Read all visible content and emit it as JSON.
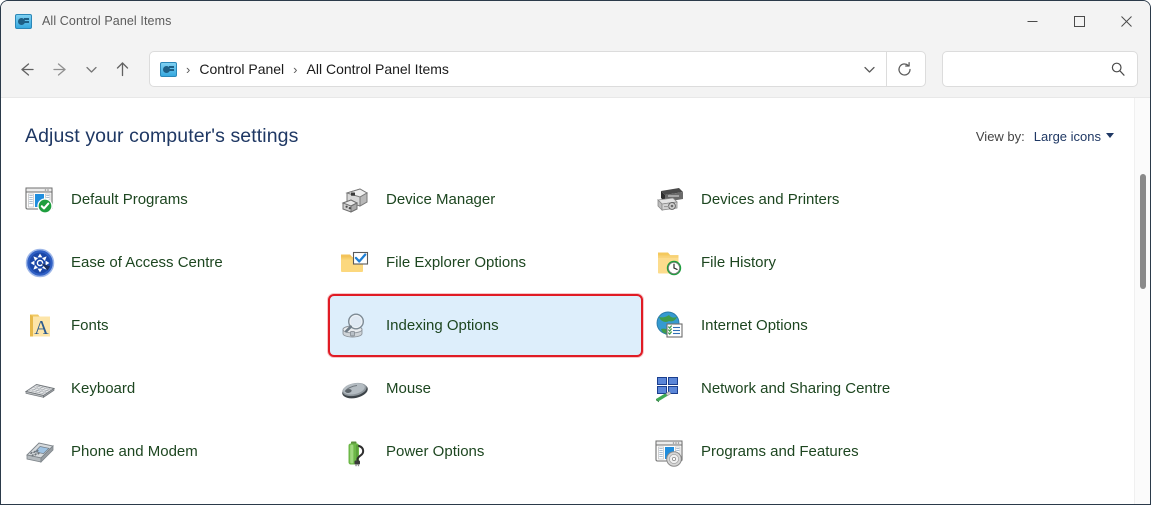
{
  "window": {
    "title": "All Control Panel Items",
    "title_icon": "control-panel-icon",
    "minimize_label": "Minimise",
    "maximize_label": "Maximise",
    "close_label": "Close"
  },
  "nav": {
    "back_label": "Back",
    "forward_label": "Forward",
    "recent_label": "Recent locations",
    "up_label": "Up",
    "dropdown_label": "Previous locations",
    "refresh_label": "Refresh",
    "breadcrumbs": [
      {
        "label": "Control Panel"
      },
      {
        "label": "All Control Panel Items"
      }
    ],
    "separator": "›"
  },
  "search": {
    "value": "",
    "placeholder": "",
    "icon": "search-icon"
  },
  "header": {
    "title": "Adjust your computer's settings",
    "view_by_label": "View by:",
    "view_by_value": "Large icons"
  },
  "colors": {
    "link_text": "#1d4620",
    "page_title": "#1f3864",
    "highlight_border": "#e01b24",
    "highlight_fill": "#ddeefb",
    "window_chrome": "#f3f3f3"
  },
  "items": [
    {
      "label": "Default Programs",
      "icon": "default-programs-icon",
      "highlighted": false
    },
    {
      "label": "Device Manager",
      "icon": "device-manager-icon",
      "highlighted": false
    },
    {
      "label": "Devices and Printers",
      "icon": "devices-and-printers-icon",
      "highlighted": false
    },
    {
      "label": "Ease of Access Centre",
      "icon": "ease-of-access-icon",
      "highlighted": false
    },
    {
      "label": "File Explorer Options",
      "icon": "file-explorer-options-icon",
      "highlighted": false
    },
    {
      "label": "File History",
      "icon": "file-history-icon",
      "highlighted": false
    },
    {
      "label": "Fonts",
      "icon": "fonts-icon",
      "highlighted": false
    },
    {
      "label": "Indexing Options",
      "icon": "indexing-options-icon",
      "highlighted": true
    },
    {
      "label": "Internet Options",
      "icon": "internet-options-icon",
      "highlighted": false
    },
    {
      "label": "Keyboard",
      "icon": "keyboard-icon",
      "highlighted": false
    },
    {
      "label": "Mouse",
      "icon": "mouse-icon",
      "highlighted": false
    },
    {
      "label": "Network and Sharing Centre",
      "icon": "network-sharing-icon",
      "highlighted": false
    },
    {
      "label": "Phone and Modem",
      "icon": "phone-and-modem-icon",
      "highlighted": false
    },
    {
      "label": "Power Options",
      "icon": "power-options-icon",
      "highlighted": false
    },
    {
      "label": "Programs and Features",
      "icon": "programs-and-features-icon",
      "highlighted": false
    }
  ],
  "scrollbar": {
    "name": "vertical-scrollbar"
  }
}
